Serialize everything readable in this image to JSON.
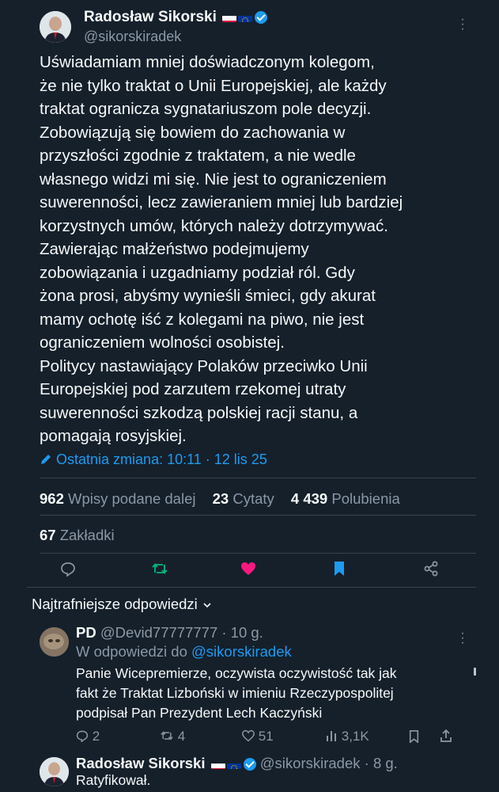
{
  "tweet": {
    "author_name": "Radosław Sikorski",
    "author_handle": "@sikorskiradek",
    "body": "Uświadamiam mniej doświadczonym kolegom,\nże nie tylko traktat o Unii Europejskiej, ale każdy\ntraktat ogranicza sygnatariuszom pole decyzji.\nZobowiązują się bowiem do zachowania w\nprzyszłości zgodnie z traktatem, a nie wedle\nwłasnego widzi mi się.  Nie jest to ograniczeniem\nsuwerenności, lecz zawieraniem mniej lub bardziej\nkorzystnych umów, których należy dotrzymywać.\nZawierając małżeństwo podejmujemy\nzobowiązania i uzgadniamy podział ról. Gdy\nżona prosi, abyśmy wynieśli śmieci, gdy akurat\nmamy ochotę iść z kolegami na piwo, nie jest\nograniczeniem wolności osobistej.\nPolitycy nastawiający Polaków przeciwko Unii\nEuropejskiej pod zarzutem rzekomej utraty\nsuwerenności szkodzą polskiej racji stanu, a\npomagają rosyjskiej.",
    "edited_label": "Ostatnia zmiana: 10:11 · 12 lis 25",
    "stats": {
      "reposts_count": "962",
      "reposts_label": "Wpisy podane dalej",
      "quotes_count": "23",
      "quotes_label": "Cytaty",
      "likes_count": "4 439",
      "likes_label": "Polubienia",
      "bookmarks_count": "67",
      "bookmarks_label": "Zakładki"
    },
    "colors": {
      "repost": "#00ba7c",
      "like": "#f91880",
      "bookmark": "#1d9bf0",
      "link": "#1d9bf0"
    }
  },
  "replies": {
    "sort_label": "Najtrafniejsze odpowiedzi",
    "items": [
      {
        "name": "PD",
        "handle": "@Devid77777777",
        "time": "· 10 g.",
        "reply_to_prefix": "W odpowiedzi do",
        "reply_to_handle": "@sikorskiradek",
        "text": "Panie Wicepremierze,  oczywista oczywistość tak jak\nfakt że Traktat Lizboński w  imieniu Rzeczypospolitej\npodpisał Pan Prezydent Lech Kaczyński",
        "replies": "2",
        "reposts": "4",
        "likes": "51",
        "views": "3,1K"
      },
      {
        "name": "Radosław Sikorski",
        "handle": "@sikorskiradek",
        "time": "· 8 g.",
        "text": "Ratyfikował."
      }
    ]
  }
}
